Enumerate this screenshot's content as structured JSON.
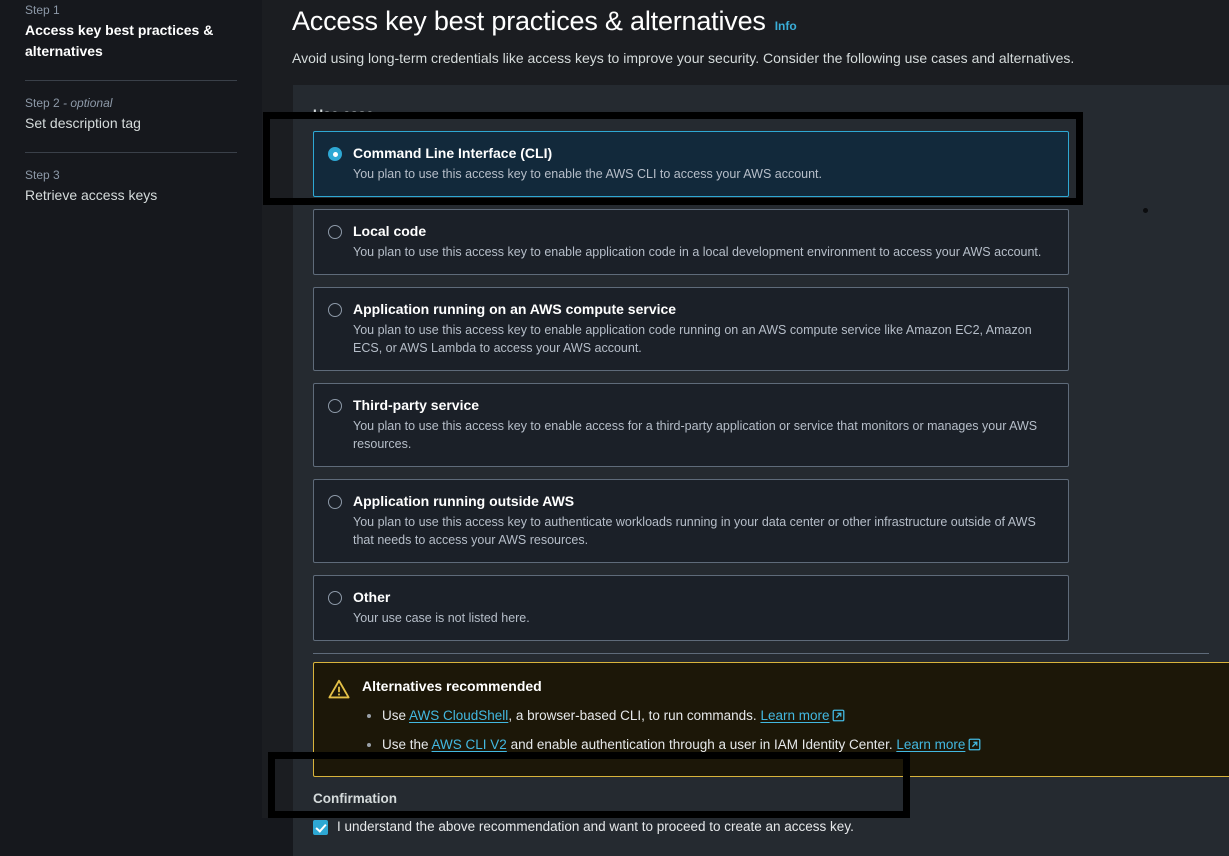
{
  "sidebar": {
    "steps": [
      {
        "label": "Step 1",
        "optional": "",
        "title": "Access key best practices & alternatives",
        "current": true
      },
      {
        "label": "Step 2",
        "optional": " - optional",
        "title": "Set description tag",
        "current": false
      },
      {
        "label": "Step 3",
        "optional": "",
        "title": "Retrieve access keys",
        "current": false
      }
    ]
  },
  "header": {
    "title": "Access key best practices & alternatives",
    "info_label": "Info",
    "description": "Avoid using long-term credentials like access keys to improve your security. Consider the following use cases and alternatives."
  },
  "form": {
    "use_case_label": "Use case",
    "options": [
      {
        "title": "Command Line Interface (CLI)",
        "description": "You plan to use this access key to enable the AWS CLI to access your AWS account.",
        "selected": true
      },
      {
        "title": "Local code",
        "description": "You plan to use this access key to enable application code in a local development environment to access your AWS account.",
        "selected": false
      },
      {
        "title": "Application running on an AWS compute service",
        "description": "You plan to use this access key to enable application code running on an AWS compute service like Amazon EC2, Amazon ECS, or AWS Lambda to access your AWS account.",
        "selected": false
      },
      {
        "title": "Third-party service",
        "description": "You plan to use this access key to enable access for a third-party application or service that monitors or manages your AWS resources.",
        "selected": false
      },
      {
        "title": "Application running outside AWS",
        "description": "You plan to use this access key to authenticate workloads running in your data center or other infrastructure outside of AWS that needs to access your AWS resources.",
        "selected": false
      },
      {
        "title": "Other",
        "description": "Your use case is not listed here.",
        "selected": false
      }
    ]
  },
  "alert": {
    "icon": "warning-triangle-icon",
    "title": "Alternatives recommended",
    "items": [
      {
        "prefix": "Use ",
        "link": "AWS CloudShell",
        "middle": ", a browser-based CLI, to run commands. ",
        "learn_more": "Learn more"
      },
      {
        "prefix": "Use the ",
        "link": "AWS CLI V2",
        "middle": " and enable authentication through a user in IAM Identity Center. ",
        "learn_more": "Learn more"
      }
    ]
  },
  "confirmation": {
    "label": "Confirmation",
    "checkbox_label": "I understand the above recommendation and want to proceed to create an access key.",
    "checked": true
  },
  "colors": {
    "accent": "#2ea8d4",
    "link": "#43b8e0",
    "warning_border": "#d9b43c",
    "warning_bg": "#1c1708",
    "panel_bg": "#252a30",
    "card_bg": "#1b2028",
    "selected_card_bg": "#12293b",
    "annotation": "#000000"
  }
}
